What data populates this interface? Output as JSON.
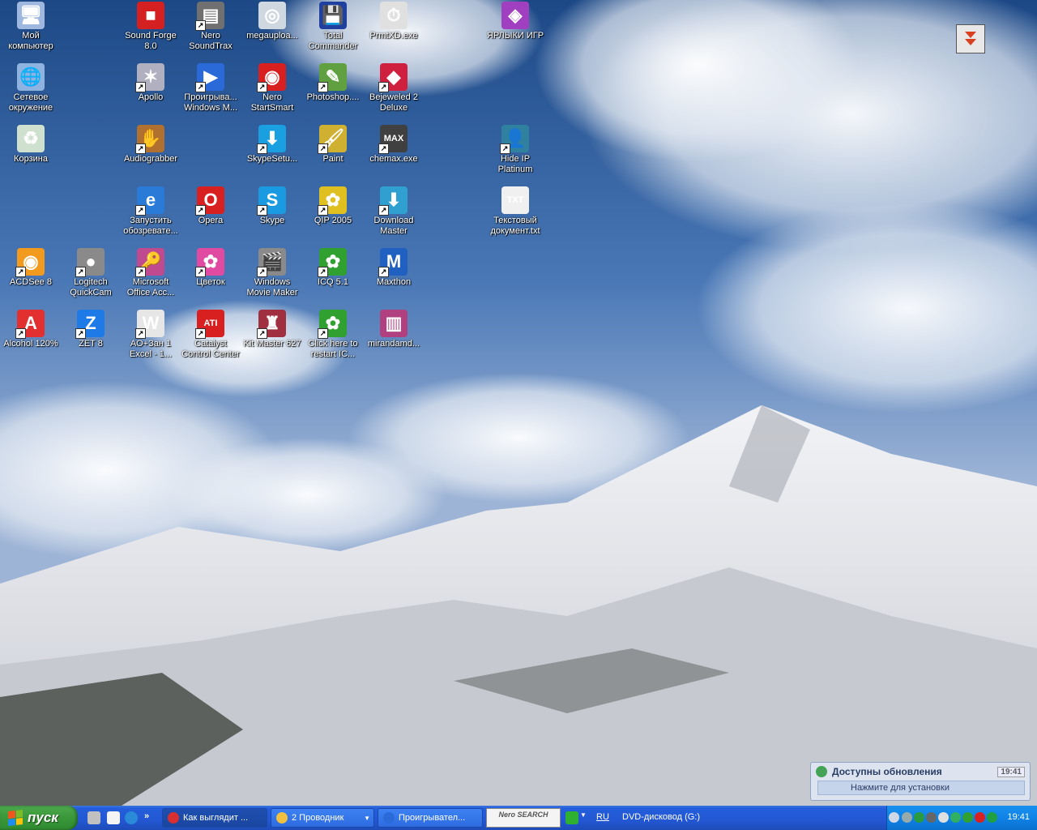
{
  "desktop_icons": [
    {
      "label": "Мой компьютер",
      "icon": "my-computer-icon",
      "shortcut": false,
      "color": "#9fb8e0",
      "glyph": "🖥"
    },
    {
      "label": "Сетевое окружение",
      "icon": "network-places-icon",
      "shortcut": false,
      "color": "#8fb3e0",
      "glyph": "🌐"
    },
    {
      "label": "Корзина",
      "icon": "recycle-bin-icon",
      "shortcut": false,
      "color": "#cfe0cf",
      "glyph": "♻"
    },
    {
      "label": "ACDSee 8",
      "icon": "acdsee-icon",
      "shortcut": true,
      "color": "#f29a1e",
      "glyph": "◉"
    },
    {
      "label": "Alcohol 120%",
      "icon": "alcohol-icon",
      "shortcut": true,
      "color": "#e23030",
      "glyph": "A"
    },
    {
      "label": "Logitech QuickCam",
      "icon": "webcam-icon",
      "shortcut": true,
      "color": "#8a8a8a",
      "glyph": "●"
    },
    {
      "label": "ZET 8",
      "icon": "zet-icon",
      "shortcut": true,
      "color": "#1e7ae6",
      "glyph": "Z"
    },
    {
      "label": "Sound Forge 8.0",
      "icon": "sound-forge-icon",
      "shortcut": false,
      "color": "#d42020",
      "glyph": "■"
    },
    {
      "label": "Apollo",
      "icon": "apollo-icon",
      "shortcut": true,
      "color": "#b0b0c0",
      "glyph": "✶"
    },
    {
      "label": "Audiograbber",
      "icon": "audiograbber-icon",
      "shortcut": true,
      "color": "#b07030",
      "glyph": "✋"
    },
    {
      "label": "Запустить обозревате...",
      "icon": "internet-explorer-icon",
      "shortcut": true,
      "color": "#2a7ad8",
      "glyph": "e"
    },
    {
      "label": "Microsoft Office Acc...",
      "icon": "ms-access-icon",
      "shortcut": true,
      "color": "#c04a90",
      "glyph": "🔑"
    },
    {
      "label": "AO+Зан 1 Excel - 1...",
      "icon": "excel-doc-icon",
      "shortcut": true,
      "color": "#e6e6e6",
      "glyph": "W"
    },
    {
      "label": "Nero SoundTrax",
      "icon": "nero-soundtrax-icon",
      "shortcut": true,
      "color": "#707070",
      "glyph": "▤"
    },
    {
      "label": "Проигрыва... Windows M...",
      "icon": "windows-media-player-icon",
      "shortcut": true,
      "color": "#2a6ad8",
      "glyph": "▶"
    },
    {
      "label": "Opera",
      "icon": "opera-icon",
      "shortcut": true,
      "color": "#d82020",
      "glyph": "O"
    },
    {
      "label": "Цветок",
      "icon": "flower-icon",
      "shortcut": true,
      "color": "#e04aa0",
      "glyph": "✿"
    },
    {
      "label": "Catalyst Control Center",
      "icon": "ati-icon",
      "shortcut": true,
      "color": "#d82020",
      "glyph": "ATI"
    },
    {
      "label": "megauploa...",
      "icon": "megaupload-icon",
      "shortcut": false,
      "color": "#cfd8e0",
      "glyph": "◎"
    },
    {
      "label": "Nero StartSmart",
      "icon": "nero-startsmart-icon",
      "shortcut": true,
      "color": "#d82020",
      "glyph": "◉"
    },
    {
      "label": "SkypeSetu...",
      "icon": "skype-setup-icon",
      "shortcut": true,
      "color": "#1aa0e0",
      "glyph": "⬇"
    },
    {
      "label": "Skype",
      "icon": "skype-icon",
      "shortcut": true,
      "color": "#1a9ae0",
      "glyph": "S"
    },
    {
      "label": "Windows Movie Maker",
      "icon": "movie-maker-icon",
      "shortcut": true,
      "color": "#8a8a8a",
      "glyph": "🎬"
    },
    {
      "label": "Kit Master 627",
      "icon": "kit-master-icon",
      "shortcut": true,
      "color": "#a03040",
      "glyph": "♜"
    },
    {
      "label": "Total Commander",
      "icon": "total-commander-icon",
      "shortcut": false,
      "color": "#2040a0",
      "glyph": "💾"
    },
    {
      "label": "Photoshop....",
      "icon": "photoshop-icon",
      "shortcut": true,
      "color": "#60a040",
      "glyph": "✎"
    },
    {
      "label": "Paint",
      "icon": "paint-icon",
      "shortcut": true,
      "color": "#d0b030",
      "glyph": "🖌"
    },
    {
      "label": "QIP 2005",
      "icon": "qip-icon",
      "shortcut": true,
      "color": "#e0c020",
      "glyph": "✿"
    },
    {
      "label": "ICQ 5.1",
      "icon": "icq-icon",
      "shortcut": true,
      "color": "#30a030",
      "glyph": "✿"
    },
    {
      "label": "Click here to restart IC...",
      "icon": "icq-restart-icon",
      "shortcut": true,
      "color": "#30a030",
      "glyph": "✿"
    },
    {
      "label": "PrmtXD.exe",
      "icon": "stopwatch-icon",
      "shortcut": false,
      "color": "#e0e0e0",
      "glyph": "⏱"
    },
    {
      "label": "Bejeweled 2 Deluxe",
      "icon": "bejeweled-icon",
      "shortcut": true,
      "color": "#d02040",
      "glyph": "◆"
    },
    {
      "label": "chemax.exe",
      "icon": "chemax-icon",
      "shortcut": true,
      "color": "#404040",
      "glyph": "MAX"
    },
    {
      "label": "Download Master",
      "icon": "download-master-icon",
      "shortcut": true,
      "color": "#30a0d0",
      "glyph": "⬇"
    },
    {
      "label": "Maxthon",
      "icon": "maxthon-icon",
      "shortcut": true,
      "color": "#2060c0",
      "glyph": "M"
    },
    {
      "label": "mirandamd...",
      "icon": "winrar-archive-icon",
      "shortcut": false,
      "color": "#b04080",
      "glyph": "▥"
    },
    {
      "label": "ЯРЛЫКИ ИГР",
      "icon": "games-folder-icon",
      "shortcut": false,
      "color": "#a040c0",
      "glyph": "◈"
    },
    {
      "label": "Hide IP Platinum",
      "icon": "hide-ip-icon",
      "shortcut": true,
      "color": "#3080a0",
      "glyph": "👤"
    },
    {
      "label": "Текстовый документ.txt",
      "icon": "text-document-icon",
      "shortcut": false,
      "color": "#f0f0f0",
      "glyph": "TXT"
    }
  ],
  "balloon": {
    "title": "Доступны обновления",
    "body": "Нажмите для установки",
    "clock": "19:41"
  },
  "taskbar": {
    "start_label": "пуск",
    "tasks": [
      {
        "label": "Как выглядит ...",
        "active": true,
        "color": "#d83030"
      },
      {
        "label": "2 Проводник",
        "active": false,
        "color": "#f0c040",
        "has_arrow": true
      },
      {
        "label": "Проигрывател...",
        "active": false,
        "color": "#2a6ad8",
        "has_arrow": false
      }
    ],
    "nero_search": "Nero SEARCH",
    "lang": "RU",
    "drive": "DVD-дисковод (G:)",
    "clock": "19:41"
  },
  "colors": {
    "taskbar": "#245edb",
    "start": "#3c9a3c",
    "tray": "#0f83e6"
  }
}
